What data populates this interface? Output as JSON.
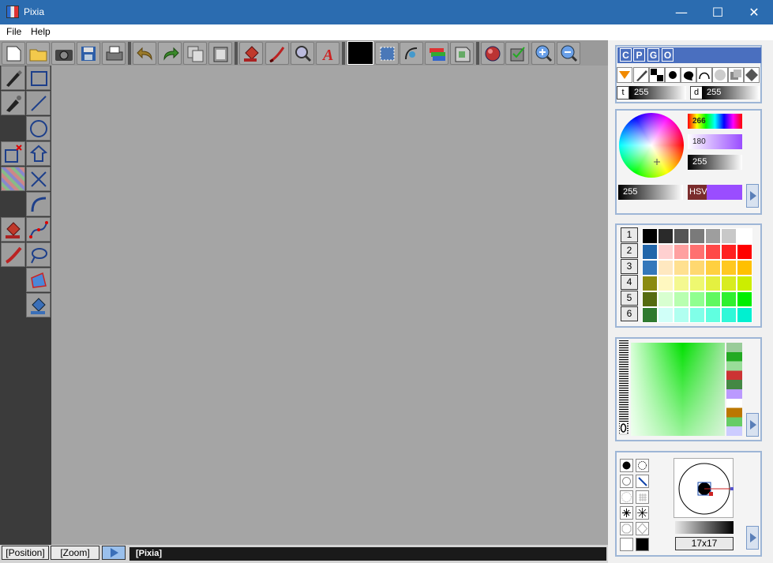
{
  "window": {
    "title": "Pixia",
    "minimize": "—",
    "maximize": "☐",
    "close": "✕"
  },
  "menu": {
    "file": "File",
    "help": "Help"
  },
  "right_dock": {
    "tabs": [
      "C",
      "P",
      "G",
      "O"
    ],
    "transparency": {
      "t_label": "t",
      "t_value": "255",
      "d_label": "d",
      "d_value": "255"
    },
    "color": {
      "hue": "266",
      "saturation": "180",
      "value": "255",
      "alpha": "255",
      "mode": "HSV"
    },
    "palette_rows": [
      "1",
      "2",
      "3",
      "4",
      "5",
      "6"
    ],
    "brush": {
      "size": "17x17"
    }
  },
  "status": {
    "position": "Position",
    "zoom": "Zoom",
    "app": "[Pixia]"
  }
}
